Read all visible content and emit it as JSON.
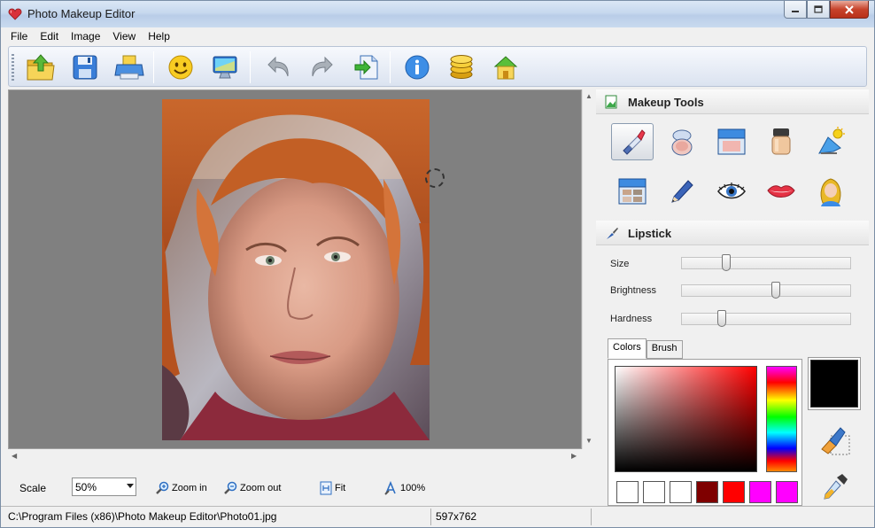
{
  "window": {
    "title": "Photo Makeup Editor"
  },
  "menu": [
    "File",
    "Edit",
    "Image",
    "View",
    "Help"
  ],
  "toolbar": {
    "buttons": [
      "open-icon",
      "save-icon",
      "print-icon",
      "smiley-icon",
      "monitor-icon",
      "undo-icon",
      "redo-icon",
      "export-icon",
      "info-icon",
      "coins-icon",
      "home-icon"
    ]
  },
  "zoom": {
    "scale_label": "Scale",
    "scale_value": "50%",
    "zoom_in": "Zoom in",
    "zoom_out": "Zoom out",
    "fit": "Fit",
    "actual": "100%"
  },
  "makeup_tools": {
    "title": "Makeup Tools",
    "items": [
      "lipstick-tool",
      "powder-tool",
      "blush-tool",
      "foundation-tool",
      "tanning-tool",
      "eyeshadow-tool",
      "pencil-tool",
      "eye-tool",
      "lips-tool",
      "hair-tool"
    ],
    "selected": "lipstick-tool"
  },
  "lipstick": {
    "title": "Lipstick",
    "size_label": "Size",
    "brightness_label": "Brightness",
    "hardness_label": "Hardness",
    "size_value": 0.25,
    "brightness_value": 0.56,
    "hardness_value": 0.22
  },
  "color_tabs": {
    "colors": "Colors",
    "brush": "Brush"
  },
  "colors": {
    "current": "#000000",
    "swatches": [
      "#ffffff",
      "#ffffff",
      "#ffffff",
      "#7f0000",
      "#ff0000",
      "#ff00ff",
      "#ff00ff"
    ]
  },
  "status": {
    "path": "C:\\Program Files (x86)\\Photo Makeup Editor\\Photo01.jpg",
    "dimensions": "597x762"
  }
}
